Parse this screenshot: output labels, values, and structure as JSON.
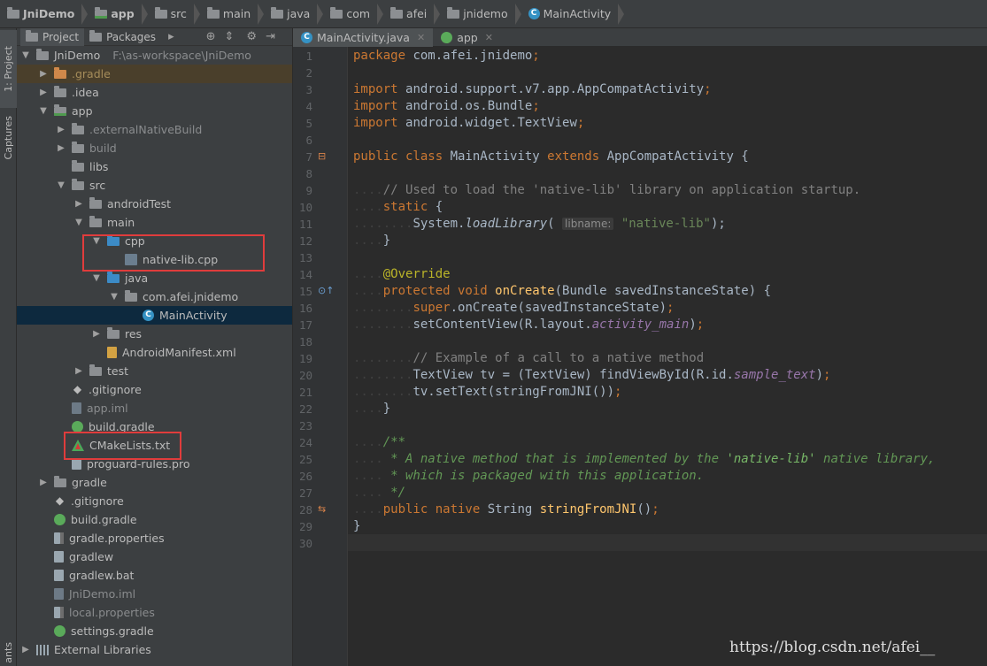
{
  "breadcrumb": [
    {
      "label": "JniDemo",
      "icon": "folder-icon",
      "bold": true
    },
    {
      "label": "app",
      "icon": "module-folder-icon",
      "bold": true
    },
    {
      "label": "src",
      "icon": "folder-icon",
      "bold": false
    },
    {
      "label": "main",
      "icon": "folder-icon",
      "bold": false
    },
    {
      "label": "java",
      "icon": "folder-icon",
      "bold": false
    },
    {
      "label": "com",
      "icon": "package-icon",
      "bold": false
    },
    {
      "label": "afei",
      "icon": "package-icon",
      "bold": false
    },
    {
      "label": "jnidemo",
      "icon": "package-icon",
      "bold": false
    },
    {
      "label": "MainActivity",
      "icon": "class-icon",
      "bold": false
    }
  ],
  "side_strip": {
    "project_label": "1: Project",
    "captures_label": "Captures",
    "bottom_label": "ants"
  },
  "project_panel": {
    "tabs": [
      {
        "label": "Project",
        "active": true
      },
      {
        "label": "Packages",
        "active": false
      }
    ],
    "tree": [
      {
        "label": "JniDemo",
        "path": "F:\\as-workspace\\JniDemo",
        "depth": 0,
        "arrow": "down",
        "icon": "folder",
        "style": "normal"
      },
      {
        "label": ".gradle",
        "depth": 1,
        "arrow": "right",
        "icon": "folder-orange",
        "style": "olive",
        "highlight": true
      },
      {
        "label": ".idea",
        "depth": 1,
        "arrow": "right",
        "icon": "folder",
        "style": "normal"
      },
      {
        "label": "app",
        "depth": 1,
        "arrow": "down",
        "icon": "folder-module",
        "style": "normal"
      },
      {
        "label": ".externalNativeBuild",
        "depth": 2,
        "arrow": "right",
        "icon": "folder",
        "style": "muted"
      },
      {
        "label": "build",
        "depth": 2,
        "arrow": "right",
        "icon": "folder",
        "style": "muted"
      },
      {
        "label": "libs",
        "depth": 2,
        "arrow": "none",
        "icon": "folder",
        "style": "normal"
      },
      {
        "label": "src",
        "depth": 2,
        "arrow": "down",
        "icon": "folder",
        "style": "normal"
      },
      {
        "label": "androidTest",
        "depth": 3,
        "arrow": "right",
        "icon": "folder",
        "style": "normal"
      },
      {
        "label": "main",
        "depth": 3,
        "arrow": "down",
        "icon": "folder",
        "style": "normal"
      },
      {
        "label": "cpp",
        "depth": 4,
        "arrow": "down",
        "icon": "folder-blue",
        "style": "normal"
      },
      {
        "label": "native-lib.cpp",
        "depth": 5,
        "arrow": "none",
        "icon": "file-cpp",
        "style": "normal"
      },
      {
        "label": "java",
        "depth": 4,
        "arrow": "down",
        "icon": "folder-blue",
        "style": "normal"
      },
      {
        "label": "com.afei.jnidemo",
        "depth": 5,
        "arrow": "down",
        "icon": "folder-package",
        "style": "normal"
      },
      {
        "label": "MainActivity",
        "depth": 6,
        "arrow": "none",
        "icon": "class",
        "style": "normal",
        "selected": true
      },
      {
        "label": "res",
        "depth": 4,
        "arrow": "right",
        "icon": "folder",
        "style": "normal"
      },
      {
        "label": "AndroidManifest.xml",
        "depth": 4,
        "arrow": "none",
        "icon": "file-xml",
        "style": "normal"
      },
      {
        "label": "test",
        "depth": 3,
        "arrow": "right",
        "icon": "folder",
        "style": "normal"
      },
      {
        "label": ".gitignore",
        "depth": 2,
        "arrow": "none",
        "icon": "file-git",
        "style": "normal"
      },
      {
        "label": "app.iml",
        "depth": 2,
        "arrow": "none",
        "icon": "file-iml",
        "style": "muted"
      },
      {
        "label": "build.gradle",
        "depth": 2,
        "arrow": "none",
        "icon": "file-gradle",
        "style": "normal"
      },
      {
        "label": "CMakeLists.txt",
        "depth": 2,
        "arrow": "none",
        "icon": "cmake",
        "style": "normal"
      },
      {
        "label": "proguard-rules.pro",
        "depth": 2,
        "arrow": "none",
        "icon": "file-txt",
        "style": "normal"
      },
      {
        "label": "gradle",
        "depth": 1,
        "arrow": "right",
        "icon": "folder",
        "style": "normal"
      },
      {
        "label": ".gitignore",
        "depth": 1,
        "arrow": "none",
        "icon": "file-git",
        "style": "normal"
      },
      {
        "label": "build.gradle",
        "depth": 1,
        "arrow": "none",
        "icon": "file-gradle",
        "style": "normal"
      },
      {
        "label": "gradle.properties",
        "depth": 1,
        "arrow": "none",
        "icon": "file-props",
        "style": "normal"
      },
      {
        "label": "gradlew",
        "depth": 1,
        "arrow": "none",
        "icon": "file-txt",
        "style": "normal"
      },
      {
        "label": "gradlew.bat",
        "depth": 1,
        "arrow": "none",
        "icon": "file-txt",
        "style": "normal"
      },
      {
        "label": "JniDemo.iml",
        "depth": 1,
        "arrow": "none",
        "icon": "file-iml",
        "style": "muted"
      },
      {
        "label": "local.properties",
        "depth": 1,
        "arrow": "none",
        "icon": "file-props",
        "style": "muted"
      },
      {
        "label": "settings.gradle",
        "depth": 1,
        "arrow": "none",
        "icon": "file-gradle",
        "style": "normal"
      },
      {
        "label": "External Libraries",
        "depth": 0,
        "arrow": "right",
        "icon": "library",
        "style": "normal"
      }
    ]
  },
  "editor_tabs": [
    {
      "label": "MainActivity.java",
      "icon": "class-icon",
      "active": true
    },
    {
      "label": "app",
      "icon": "gradle-icon",
      "active": false
    }
  ],
  "code_lines": [
    [
      [
        "k",
        "package "
      ],
      [
        "t",
        "com.afei.jnidemo"
      ],
      [
        "k",
        ";"
      ]
    ],
    [],
    [
      [
        "k",
        "import "
      ],
      [
        "t",
        "android.support.v7.app.AppCompatActivity"
      ],
      [
        "k",
        ";"
      ]
    ],
    [
      [
        "k",
        "import "
      ],
      [
        "t",
        "android.os.Bundle"
      ],
      [
        "k",
        ";"
      ]
    ],
    [
      [
        "k",
        "import "
      ],
      [
        "t",
        "android.widget.TextView"
      ],
      [
        "k",
        ";"
      ]
    ],
    [],
    [
      [
        "k",
        "public class "
      ],
      [
        "t",
        "MainActivity "
      ],
      [
        "k",
        "extends "
      ],
      [
        "t",
        "AppCompatActivity {"
      ]
    ],
    [],
    [
      [
        "ws",
        "...."
      ],
      [
        "c",
        "// Used to load the 'native-lib' library on application startup."
      ]
    ],
    [
      [
        "ws",
        "...."
      ],
      [
        "k",
        "static "
      ],
      [
        "t",
        "{"
      ]
    ],
    [
      [
        "ws",
        "........"
      ],
      [
        "t",
        "System."
      ],
      [
        "fi",
        "loadLibrary"
      ],
      [
        "t",
        "( "
      ],
      [
        "hint",
        "libname:"
      ],
      [
        "t",
        " "
      ],
      [
        "s",
        "\"native-lib\""
      ],
      [
        "t",
        ");"
      ]
    ],
    [
      [
        "ws",
        "...."
      ],
      [
        "t",
        "}"
      ]
    ],
    [],
    [
      [
        "ws",
        "...."
      ],
      [
        "a",
        "@Override"
      ]
    ],
    [
      [
        "ws",
        "...."
      ],
      [
        "k",
        "protected void "
      ],
      [
        "fn",
        "onCreate"
      ],
      [
        "t",
        "(Bundle savedInstanceState) {"
      ]
    ],
    [
      [
        "ws",
        "........"
      ],
      [
        "k",
        "super"
      ],
      [
        "t",
        ".onCreate(savedInstanceState)"
      ],
      [
        "k",
        ";"
      ]
    ],
    [
      [
        "ws",
        "........"
      ],
      [
        "t",
        "setContentView(R.layout."
      ],
      [
        "st",
        "activity_main"
      ],
      [
        "t",
        ")"
      ],
      [
        "k",
        ";"
      ]
    ],
    [],
    [
      [
        "ws",
        "........"
      ],
      [
        "c",
        "// Example of a call to a native method"
      ]
    ],
    [
      [
        "ws",
        "........"
      ],
      [
        "t",
        "TextView tv = (TextView) findViewById(R.id."
      ],
      [
        "st",
        "sample_text"
      ],
      [
        "t",
        ")"
      ],
      [
        "k",
        ";"
      ]
    ],
    [
      [
        "ws",
        "........"
      ],
      [
        "t",
        "tv.setText(stringFromJNI())"
      ],
      [
        "k",
        ";"
      ]
    ],
    [
      [
        "ws",
        "...."
      ],
      [
        "t",
        "}"
      ]
    ],
    [],
    [
      [
        "ws",
        "...."
      ],
      [
        "cm",
        "/**"
      ]
    ],
    [
      [
        "ws",
        "...."
      ],
      [
        "cm",
        " * A native method that is implemented by the "
      ],
      [
        "cmd",
        "'native-lib'"
      ],
      [
        "cm",
        " native library,"
      ]
    ],
    [
      [
        "ws",
        "...."
      ],
      [
        "cm",
        " * which is packaged with this application."
      ]
    ],
    [
      [
        "ws",
        "...."
      ],
      [
        "cm",
        " */"
      ]
    ],
    [
      [
        "ws",
        "...."
      ],
      [
        "k",
        "public native "
      ],
      [
        "t",
        "String "
      ],
      [
        "fn",
        "stringFromJNI"
      ],
      [
        "t",
        "()"
      ],
      [
        "k",
        ";"
      ]
    ],
    [
      [
        "t",
        "}"
      ]
    ],
    []
  ],
  "watermark": "https://blog.csdn.net/afei__"
}
